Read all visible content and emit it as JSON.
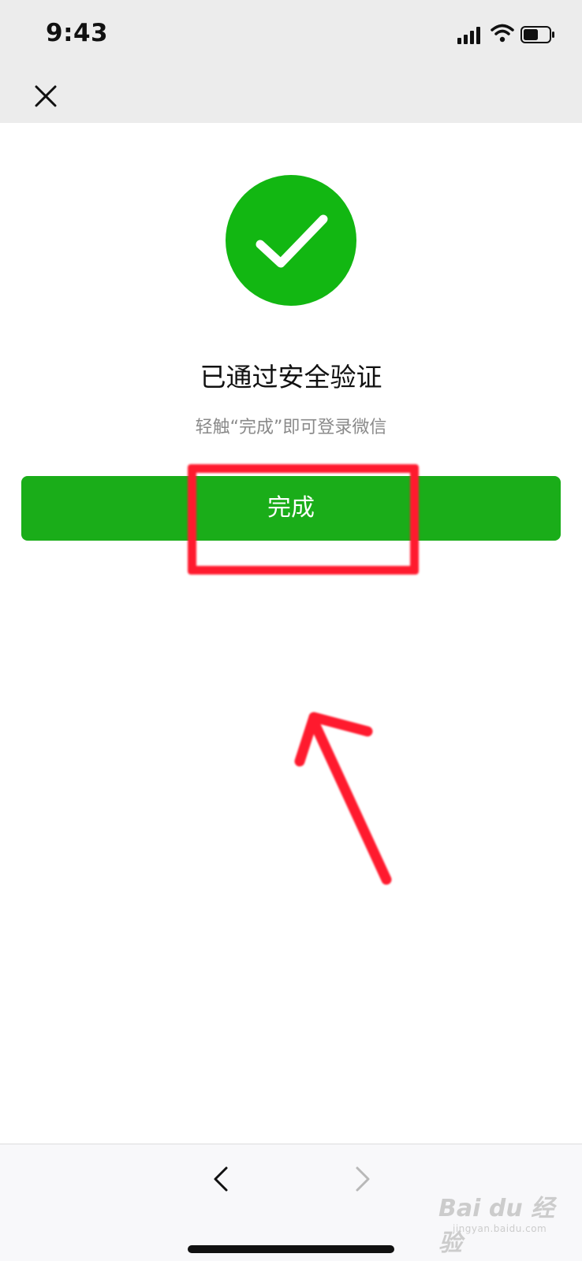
{
  "status_bar": {
    "time": "9:43"
  },
  "result": {
    "title": "已通过安全验证",
    "subtitle": "轻触“完成”即可登录微信",
    "done_label": "完成"
  },
  "colors": {
    "success_green": "#12b712",
    "button_green": "#1aad19",
    "annotation_red": "#ff1a2e"
  },
  "icons": {
    "close": "close-icon",
    "check": "checkmark-icon",
    "back": "chevron-left-icon",
    "forward": "chevron-right-icon"
  },
  "watermark": {
    "main": "Bai du 经验",
    "url": "jingyan.baidu.com"
  }
}
